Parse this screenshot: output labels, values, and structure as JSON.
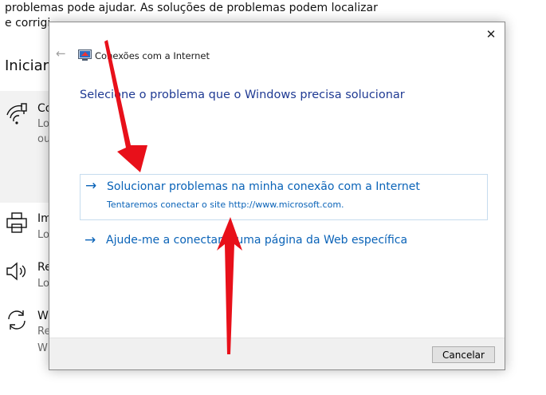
{
  "background": {
    "intro_line1": "problemas pode ajudar. As soluções de problemas podem localizar",
    "intro_line2": "e corrigi",
    "heading": "Iniciar",
    "items": [
      {
        "icon": "wifi-icon",
        "title": "Co",
        "desc_lines": [
          "Lo",
          "ou"
        ]
      },
      {
        "icon": "printer-icon",
        "title": "Im",
        "desc_lines": [
          "Lo"
        ]
      },
      {
        "icon": "speaker-icon",
        "title": "Re",
        "desc_lines": [
          "Lo"
        ]
      },
      {
        "icon": "sync-icon",
        "title": "W",
        "desc_lines": [
          "Re",
          "W"
        ]
      }
    ]
  },
  "dialog": {
    "title": "Conexões com a Internet",
    "back_icon": "back-arrow-icon",
    "app_icon": "network-icon",
    "close_label": "✕",
    "question": "Selecione o problema que o Windows precisa solucionar",
    "options": [
      {
        "arrow": "→",
        "label": "Solucionar problemas na minha conexão com a Internet",
        "description": "Tentaremos conectar o site http://www.microsoft.com."
      },
      {
        "arrow": "→",
        "label": "Ajude-me a conectar a uma página da Web específica"
      }
    ],
    "cancel_label": "Cancelar"
  },
  "annotations": {
    "color": "#e8101a",
    "arrows": [
      "down-arrow",
      "up-arrow"
    ]
  },
  "colors": {
    "link": "#0a63b8",
    "question": "#1f3a93",
    "footer": "#f0f0f0"
  }
}
